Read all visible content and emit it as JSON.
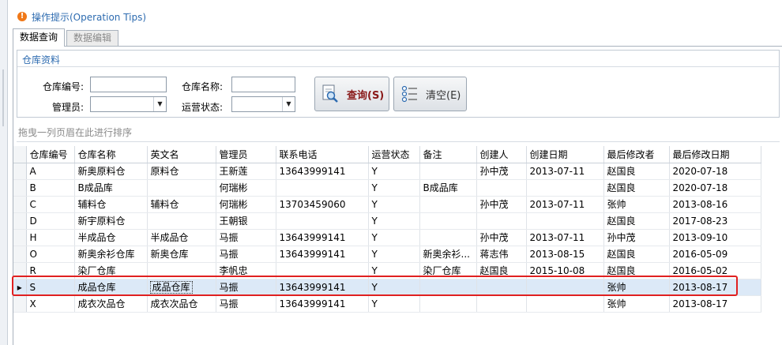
{
  "tips": {
    "icon": "exclamation-icon",
    "text": "操作提示(Operation Tips)"
  },
  "tabs": [
    {
      "label": "数据查询"
    },
    {
      "label": "数据编辑"
    }
  ],
  "group": {
    "title": "仓库资料",
    "fields": {
      "code_label": "仓库编号:",
      "code_value": "",
      "name_label": "仓库名称:",
      "name_value": "",
      "manager_label": "管理员:",
      "manager_value": "",
      "status_label": "运营状态:",
      "status_value": ""
    },
    "buttons": {
      "query_label": "查询(S)",
      "clear_label": "清空(E)"
    }
  },
  "grid": {
    "group_hint": "拖曳一列页眉在此进行排序",
    "columns": [
      "仓库编号",
      "仓库名称",
      "英文名",
      "管理员",
      "联系电话",
      "运营状态",
      "备注",
      "创建人",
      "创建日期",
      "最后修改者",
      "最后修改日期"
    ],
    "rows": [
      [
        "A",
        "新奥原料仓",
        "原料仓",
        "王新莲",
        "13643999141",
        "Y",
        "",
        "孙中茂",
        "2013-07-11",
        "赵国良",
        "2020-07-18"
      ],
      [
        "B",
        "B成品库",
        "",
        "何瑞彬",
        "",
        "Y",
        "B成品库",
        "",
        "",
        "赵国良",
        "2020-07-18"
      ],
      [
        "C",
        "辅料仓",
        "辅料仓",
        "何瑞彬",
        "13703459060",
        "Y",
        "",
        "孙中茂",
        "2013-07-11",
        "张帅",
        "2013-08-16"
      ],
      [
        "D",
        "新宇原料仓",
        "",
        "王朝银",
        "",
        "Y",
        "",
        "",
        "",
        "赵国良",
        "2017-08-23"
      ],
      [
        "H",
        "半成品仓",
        "半成品仓",
        "马振",
        "13643999141",
        "Y",
        "",
        "孙中茂",
        "2013-07-11",
        "孙中茂",
        "2013-09-10"
      ],
      [
        "O",
        "新奥余衫仓库",
        "新奥仓库",
        "马振",
        "13643999141",
        "Y",
        "新奥余衫...",
        "蒋志伟",
        "2013-08-15",
        "赵国良",
        "2016-05-09"
      ],
      [
        "R",
        "染厂仓库",
        "",
        "李帆忠",
        "",
        "Y",
        "染厂仓库",
        "赵国良",
        "2015-10-08",
        "赵国良",
        "2016-05-02"
      ],
      [
        "S",
        "成品仓库",
        "成品仓库",
        "马振",
        "13643999141",
        "Y",
        "",
        "",
        "",
        "张帅",
        "2013-08-17"
      ],
      [
        "X",
        "成衣次品仓",
        "成衣次品仓",
        "马振",
        "13643999141",
        "Y",
        "",
        "",
        "",
        "张帅",
        "2013-08-17"
      ]
    ],
    "selected_row_index": 7,
    "row_indicator": "▸"
  },
  "colors": {
    "accent": "#2d6bb0",
    "selection": "#dce9f7",
    "highlight": "#e02020",
    "query_text": "#8a1a1a"
  }
}
